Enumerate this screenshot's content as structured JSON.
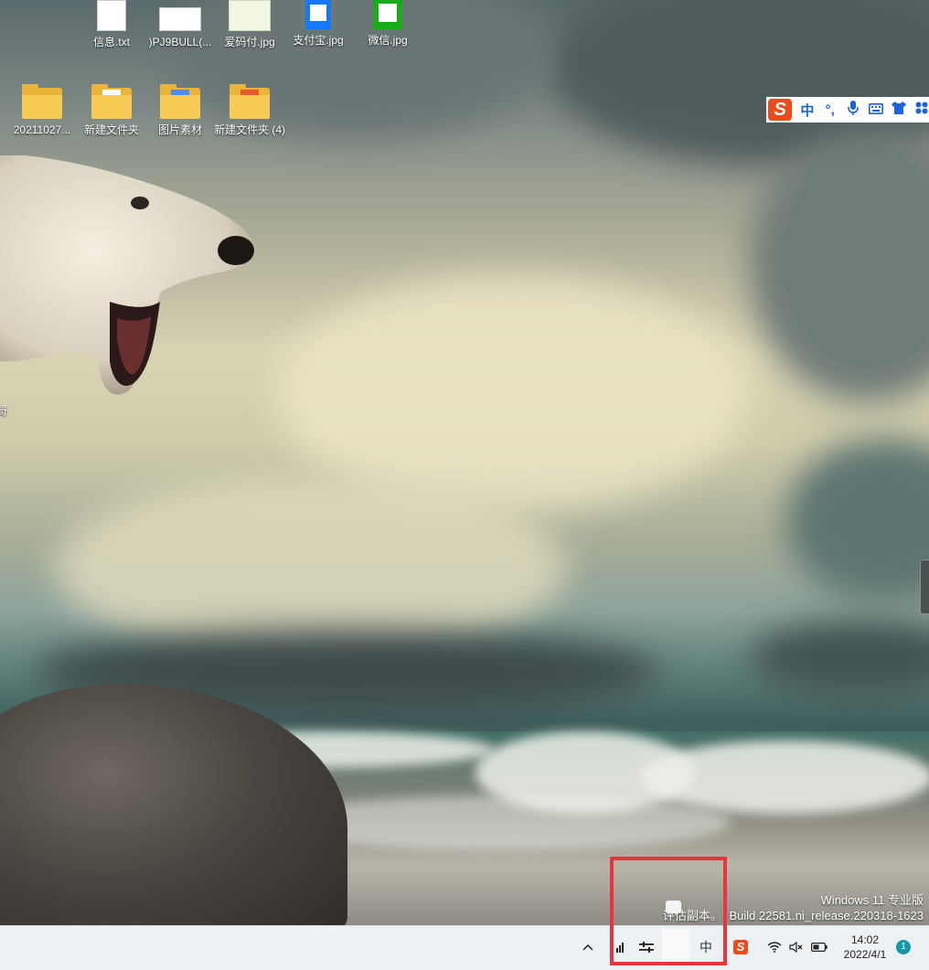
{
  "desktop": {
    "icons_row1": [
      {
        "label": "信息.txt",
        "kind": "file"
      },
      {
        "label": ")PJ9BULL(...",
        "kind": "image"
      },
      {
        "label": "爱码付.jpg",
        "kind": "image"
      },
      {
        "label": "支付宝.jpg",
        "kind": "image"
      },
      {
        "label": "微信.jpg",
        "kind": "image"
      }
    ],
    "icons_row2": [
      {
        "label": "20211027...",
        "kind": "folder"
      },
      {
        "label": "新建文件夹",
        "kind": "folder"
      },
      {
        "label": "图片素材",
        "kind": "folder"
      },
      {
        "label": "新建文件夹 (4)",
        "kind": "folder"
      }
    ],
    "side_fragment": "哥"
  },
  "ime_bar": {
    "logo": "S",
    "mode_label": "中",
    "punct_label": "°,",
    "icons": [
      "microphone-icon",
      "keyboard-icon",
      "skin-icon",
      "toolbox-icon"
    ]
  },
  "watermark": {
    "line1": "Windows 11 专业版",
    "line2_prefix": "评估副本。",
    "line2": "Build 22581.ni_release.220318-1623"
  },
  "taskbar": {
    "tray_chevron": "^",
    "ime_indicator": "中",
    "sogou_logo": "S",
    "time": "14:02",
    "date": "2022/4/1",
    "notification_count": "1"
  },
  "colors": {
    "taskbar_bg": "#eef1f4",
    "highlight": "#e8343c",
    "ime_accent": "#1a63d8",
    "sogou_red": "#e94b1b",
    "badge": "#1497a8"
  }
}
